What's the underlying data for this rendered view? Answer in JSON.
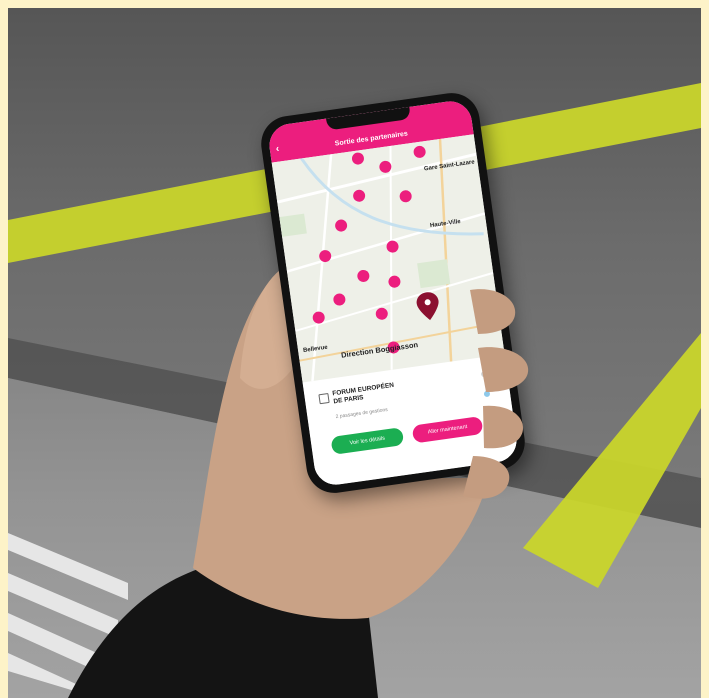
{
  "app": {
    "title": "Sortie des partenaires",
    "back_icon": "back-arrow-icon"
  },
  "map": {
    "labels": [
      "Direction Boggiasson",
      "Gare Saint-Lazare",
      "Haute-Ville",
      "Bellevue"
    ],
    "pin_color": "#ec1e7e",
    "selected_pin_color": "#8b1030"
  },
  "sheet": {
    "poi_name": "FORUM EUROPÉEN\nDE PARIS",
    "poi_sub": "2 passages de gestions",
    "left_button": "Voir les détails",
    "right_button": "Aller maintenant"
  },
  "colors": {
    "accent": "#ec1e7e",
    "green": "#1bae52",
    "road_marking": "#c9d52b"
  }
}
